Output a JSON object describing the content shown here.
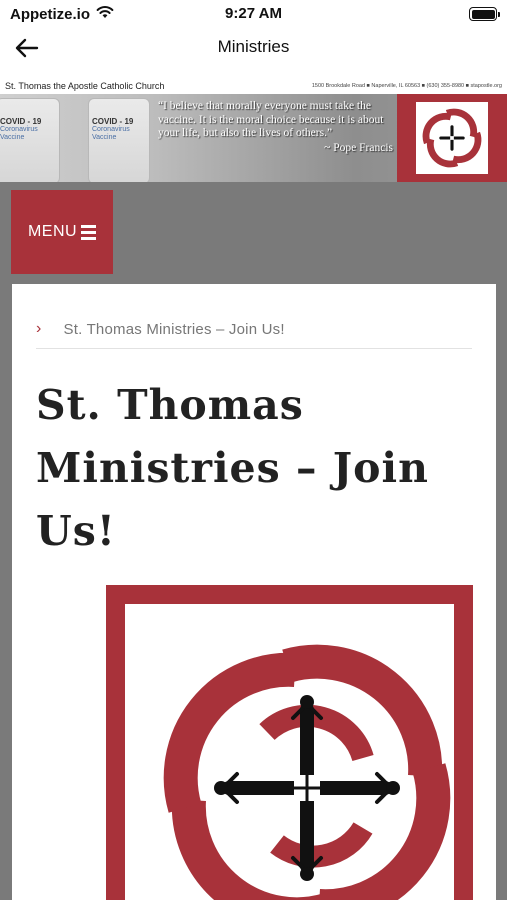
{
  "status_bar": {
    "carrier": "Appetize.io",
    "time": "9:27 AM"
  },
  "nav": {
    "title": "Ministries"
  },
  "church": {
    "name": "St. Thomas the Apostle Catholic Church",
    "address": "1500 Brookdale Road  ■  Naperville, IL 60563  ■  (630) 355-8980  ■  stapostle.org"
  },
  "banner": {
    "vials": [
      {
        "title": "COVID - 19",
        "subtitle": "Coronavirus Vaccine"
      },
      {
        "title": "COVID - 19",
        "subtitle": "Coronavirus Vaccine"
      }
    ],
    "quote": "“I believe that morally everyone must take the vaccine. It is the moral choice because it is about your life, but also the lives of others.”",
    "quote_author": "~ Pope Francis"
  },
  "menu": {
    "label": "MENU"
  },
  "breadcrumb": {
    "current": "St. Thomas Ministries – Join Us!"
  },
  "page": {
    "title": "St. Thomas Ministries – Join Us!"
  },
  "colors": {
    "brand_red": "#a8323a",
    "page_gray": "#7a7a7a"
  },
  "icons": {
    "back": "arrow-left-icon",
    "wifi": "wifi-icon",
    "battery": "battery-icon",
    "menu": "hamburger-icon",
    "breadcrumb_separator": "chevron-right-icon",
    "logo": "swirl-cross-logo"
  }
}
